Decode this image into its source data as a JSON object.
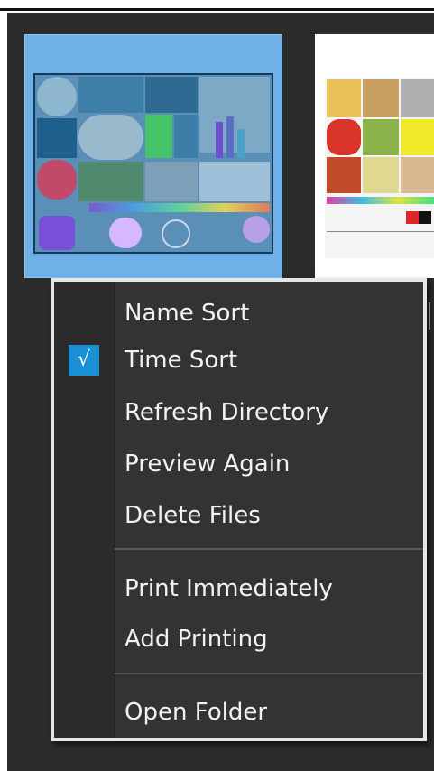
{
  "menu": {
    "items": [
      {
        "label": "Name Sort",
        "checked": false
      },
      {
        "label": "Time Sort",
        "checked": true,
        "check_glyph": "√"
      },
      {
        "label": "Refresh Directory",
        "checked": false
      },
      {
        "label": "Preview Again",
        "checked": false
      },
      {
        "label": "Delete Files",
        "checked": false
      },
      {
        "label": "Print Immediately",
        "checked": false
      },
      {
        "label": "Add Printing",
        "checked": false
      },
      {
        "label": "Open Folder",
        "checked": false
      }
    ]
  },
  "colors": {
    "window_bg": "#2b2b2b",
    "menu_bg": "#333333",
    "menu_border": "#e6e6e6",
    "selection": "#6fb1e6",
    "check_bg": "#1a8fd4",
    "text": "#f2f2f2"
  }
}
